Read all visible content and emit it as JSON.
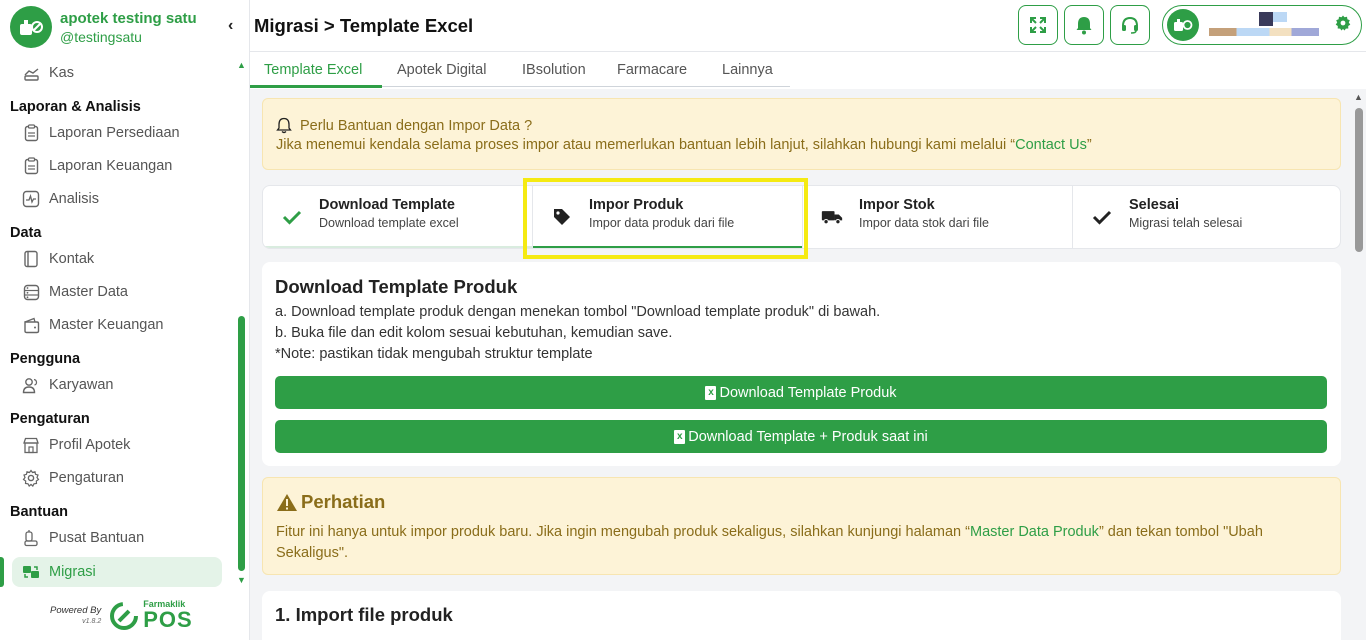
{
  "brand": {
    "name": "apotek testing satu",
    "handle": "@testingsatu"
  },
  "sidebar": {
    "collapse_label": "‹",
    "items": [
      {
        "type": "item",
        "label": "Kas",
        "icon": "cash-icon",
        "active": false
      },
      {
        "type": "header",
        "label": "Laporan & Analisis"
      },
      {
        "type": "item",
        "label": "Laporan Persediaan",
        "icon": "clipboard-icon",
        "active": false
      },
      {
        "type": "item",
        "label": "Laporan Keuangan",
        "icon": "clipboard-icon",
        "active": false
      },
      {
        "type": "item",
        "label": "Analisis",
        "icon": "chart-pulse-icon",
        "active": false
      },
      {
        "type": "header",
        "label": "Data"
      },
      {
        "type": "item",
        "label": "Kontak",
        "icon": "contact-book-icon",
        "active": false
      },
      {
        "type": "item",
        "label": "Master Data",
        "icon": "database-icon",
        "active": false
      },
      {
        "type": "item",
        "label": "Master Keuangan",
        "icon": "wallet-icon",
        "active": false
      },
      {
        "type": "header",
        "label": "Pengguna"
      },
      {
        "type": "item",
        "label": "Karyawan",
        "icon": "users-icon",
        "active": false
      },
      {
        "type": "header",
        "label": "Pengaturan"
      },
      {
        "type": "item",
        "label": "Profil Apotek",
        "icon": "store-icon",
        "active": false
      },
      {
        "type": "item",
        "label": "Pengaturan",
        "icon": "gear-icon",
        "active": false
      },
      {
        "type": "header",
        "label": "Bantuan"
      },
      {
        "type": "item",
        "label": "Pusat Bantuan",
        "icon": "help-hand-icon",
        "active": false
      },
      {
        "type": "item",
        "label": "Migrasi",
        "icon": "migrate-icon",
        "active": true
      }
    ],
    "powered_by": "Powered By",
    "version": "v1.8.2",
    "logo_small": "Farmaklik",
    "logo_big": "POS"
  },
  "header": {
    "title": "Migrasi > Template Excel"
  },
  "tabs": [
    "Template Excel",
    "Apotek Digital",
    "IBsolution",
    "Farmacare",
    "Lainnya"
  ],
  "notice": {
    "title": "Perlu Bantuan dengan Impor Data ?",
    "body_prefix": "Jika menemui kendala selama proses impor atau memerlukan bantuan lebih lanjut, silahkan hubungi kami melalui “",
    "link": "Contact Us",
    "body_suffix": "”"
  },
  "steps": [
    {
      "title": "Download Template",
      "subtitle": "Download template excel",
      "icon": "check-icon",
      "status": "done"
    },
    {
      "title": "Impor Produk",
      "subtitle": "Impor data produk dari file",
      "icon": "tag-icon",
      "status": "active"
    },
    {
      "title": "Impor Stok",
      "subtitle": "Impor data stok dari file",
      "icon": "truck-icon",
      "status": "pending"
    },
    {
      "title": "Selesai",
      "subtitle": "Migrasi telah selesai",
      "icon": "checkmark-icon",
      "status": "pending"
    }
  ],
  "download_card": {
    "title": "Download Template Produk",
    "line_a": "a. Download template produk dengan menekan tombol \"Download template produk\" di bawah.",
    "line_b": "b. Buka file dan edit kolom sesuai kebutuhan, kemudian save.",
    "note": "*Note: pastikan tidak mengubah struktur template",
    "button_1": "Download Template Produk",
    "button_2": "Download Template + Produk saat ini"
  },
  "warning": {
    "title": "Perhatian",
    "body_prefix": "Fitur ini hanya untuk impor produk baru. Jika ingin mengubah produk sekaligus, silahkan kunjungi halaman “",
    "link": "Master Data Produk",
    "body_suffix": "” dan tekan tombol \"Ubah Sekaligus\"."
  },
  "import_card": {
    "title": "1. Import file produk"
  },
  "colors": {
    "accent": "#2e9e46",
    "notice_bg": "#fdf3d7",
    "notice_text": "#8a6d1a",
    "highlight": "#f5ea12"
  }
}
